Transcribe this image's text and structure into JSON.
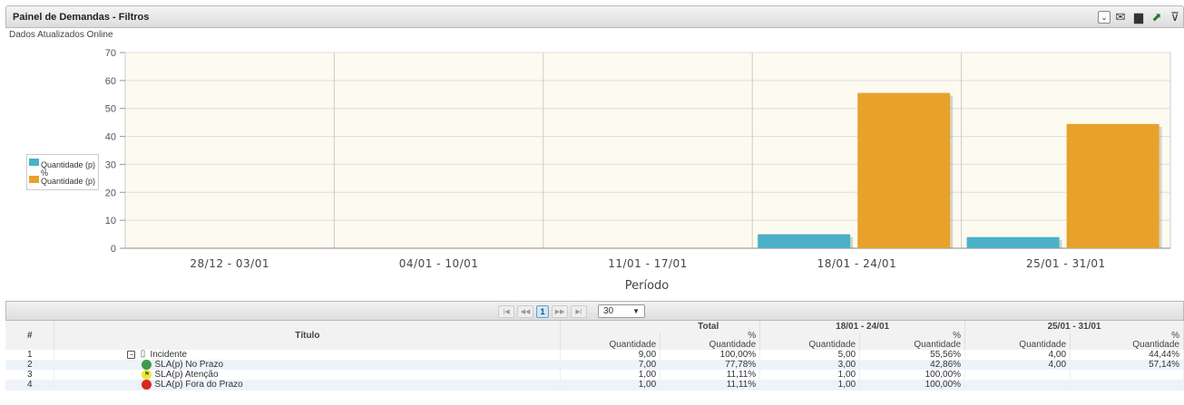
{
  "header": {
    "title": "Painel de Demandas - Filtros",
    "icons": [
      "dropdown-icon",
      "email-icon",
      "print-icon",
      "export-icon",
      "filter-icon"
    ]
  },
  "subtitle": "Dados Atualizados Online",
  "chart_data": {
    "type": "bar",
    "categories": [
      "28/12 - 03/01",
      "04/01 - 10/01",
      "11/01 - 17/01",
      "18/01 - 24/01",
      "25/01 - 31/01"
    ],
    "series": [
      {
        "name": "Quantidade (p)",
        "color": "#4bb0c8",
        "values": [
          0,
          0,
          0,
          5,
          4
        ]
      },
      {
        "name": "% Quantidade (p)",
        "color": "#e8a22c",
        "values": [
          0,
          0,
          0,
          55.56,
          44.44
        ]
      }
    ],
    "xlabel": "Período",
    "ylabel": "",
    "ylim": [
      0,
      70
    ],
    "yticks": [
      0,
      10,
      20,
      30,
      40,
      50,
      60,
      70
    ],
    "grid": true,
    "legend_position": "left",
    "background": "#fdfaf0"
  },
  "legend": {
    "item1": "Quantidade (p)",
    "item2_pct": "%",
    "item2": "Quantidade (p)"
  },
  "pager": {
    "first": "|◀",
    "prev": "◀◀",
    "current": "1",
    "next": "▶▶",
    "last": "▶|",
    "page_size": "30"
  },
  "table": {
    "col_num": "#",
    "col_title": "Título",
    "groups": [
      "Total",
      "18/01 - 24/01",
      "25/01 - 31/01"
    ],
    "sub_qty": "Quantidade",
    "sub_pct_top": "%",
    "sub_pct_bottom": "Quantidade",
    "rows": [
      {
        "num": "1",
        "title": "Incidente",
        "icon": "clipboard-icon",
        "t_q": "9,00",
        "t_p": "100,00%",
        "a_q": "5,00",
        "a_p": "55,56%",
        "b_q": "4,00",
        "b_p": "44,44%"
      },
      {
        "num": "2",
        "title": "SLA(p) No Prazo",
        "icon": "green-circle-icon",
        "t_q": "7,00",
        "t_p": "77,78%",
        "a_q": "3,00",
        "a_p": "42,86%",
        "b_q": "4,00",
        "b_p": "57,14%"
      },
      {
        "num": "3",
        "title": "SLA(p) Atenção",
        "icon": "yellow-flag-icon",
        "t_q": "1,00",
        "t_p": "11,11%",
        "a_q": "1,00",
        "a_p": "100,00%",
        "b_q": "",
        "b_p": ""
      },
      {
        "num": "4",
        "title": "SLA(p) Fora do Prazo",
        "icon": "red-circle-icon",
        "t_q": "1,00",
        "t_p": "11,11%",
        "a_q": "1,00",
        "a_p": "100,00%",
        "b_q": "",
        "b_p": ""
      }
    ]
  }
}
